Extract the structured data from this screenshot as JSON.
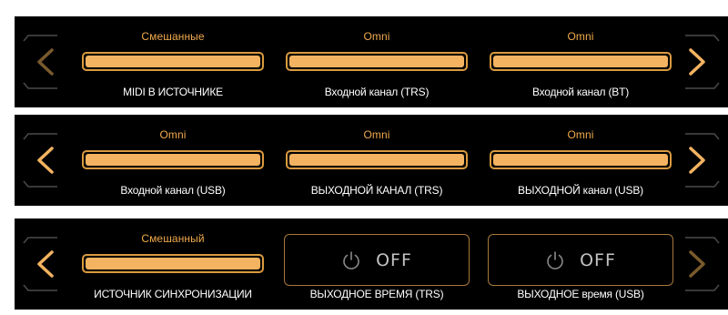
{
  "colors": {
    "accent": "#f0a94c",
    "bar_fill": "#f3b361",
    "bar_border": "#d99a3f",
    "label": "#ffffff",
    "toggle_text": "#c2c2c2",
    "arrow_dim": "#7a5a2d"
  },
  "panels": [
    {
      "slots": [
        {
          "value": "Смешанные",
          "label": "MIDI В ИСТОЧНИКЕ"
        },
        {
          "value": "Omni",
          "label": "Входной канал (TRS)"
        },
        {
          "value": "Omni",
          "label": "Входной канал (BT)"
        }
      ],
      "nav": {
        "left": "chevron-left-icon (dimmed)",
        "right": "chevron-right-icon"
      }
    },
    {
      "slots": [
        {
          "value": "Omni",
          "label": "Входной канал (USB)"
        },
        {
          "value": "Omni",
          "label": "ВЫХОДНОЙ КАНАЛ (TRS)"
        },
        {
          "value": "Omni",
          "label": "ВЫХОДНОЙ канал (USB)"
        }
      ],
      "nav": {
        "left": "chevron-left-icon",
        "right": "chevron-right-icon"
      }
    },
    {
      "slots": [
        {
          "value": "Смешанный",
          "label": "ИСТОЧНИК СИНХРОНИЗАЦИИ"
        },
        {
          "state": "OFF",
          "label": "ВЫХОДНОЕ ВРЕМЯ (TRS)"
        },
        {
          "state": "OFF",
          "label": "ВЫХОДНОЕ время (USB)"
        }
      ],
      "nav": {
        "left": "chevron-left-icon",
        "right": "chevron-right-icon (dimmed)"
      }
    }
  ]
}
